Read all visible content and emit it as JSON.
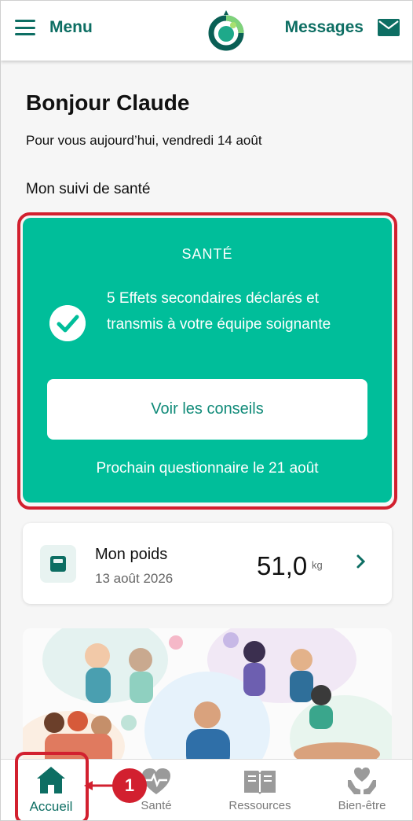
{
  "header": {
    "menu_label": "Menu",
    "messages_label": "Messages"
  },
  "greeting": "Bonjour Claude",
  "subtitle": "Pour vous aujourd’hui, vendredi 14 août",
  "section_title": "Mon suivi de santé",
  "health_card": {
    "label": "SANTÉ",
    "message": "5 Effets secondaires déclarés et transmis à votre équipe soignante",
    "button_label": "Voir les conseils",
    "next_questionnaire": "Prochain questionnaire le 21 août"
  },
  "weight_card": {
    "title": "Mon poids",
    "date": "13 août 2026",
    "value": "51,0",
    "unit": "kg"
  },
  "annotation_badge": "1",
  "bottom_nav": {
    "items": [
      {
        "label": "Accueil",
        "icon": "home-icon"
      },
      {
        "label": "Santé",
        "icon": "heart-pulse-icon"
      },
      {
        "label": "Ressources",
        "icon": "book-icon"
      },
      {
        "label": "Bien-être",
        "icon": "hands-heart-icon"
      }
    ]
  },
  "colors": {
    "brand": "#0d6e63",
    "card_green": "#00be9a",
    "highlight_red": "#d2202f"
  }
}
